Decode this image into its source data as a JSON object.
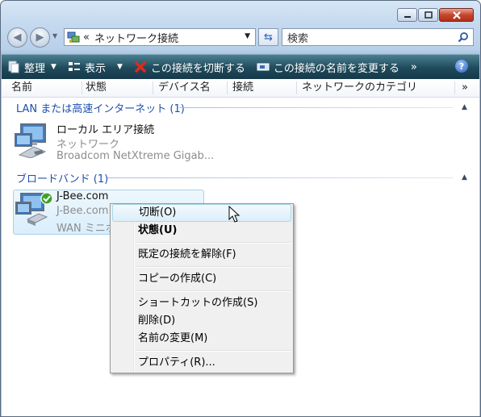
{
  "nav": {
    "address_prefix": "«",
    "address": "ネットワーク接続",
    "search_placeholder": "検索"
  },
  "toolbar": {
    "organize": "整理",
    "view": "表示",
    "disconnect": "この接続を切断する",
    "rename": "この接続の名前を変更する",
    "more": "»",
    "help": "?"
  },
  "columns": [
    "名前",
    "状態",
    "デバイス名",
    "接続",
    "ネットワークのカテゴリ"
  ],
  "columns_more": "»",
  "groups": [
    {
      "title": "LAN または高速インターネット (1)",
      "items": [
        {
          "name": "ローカル エリア接続",
          "status": "ネットワーク",
          "device": "Broadcom NetXtreme Gigab..."
        }
      ]
    },
    {
      "title": "ブロードバンド (1)",
      "items": [
        {
          "name": "J-Bee.com",
          "status": "J-Bee.com",
          "device": "WAN ミニポ"
        }
      ]
    }
  ],
  "context_menu": {
    "items": [
      "切断(O)",
      "状態(U)",
      "既定の接続を解除(F)",
      "コピーの作成(C)",
      "ショートカットの作成(S)",
      "削除(D)",
      "名前の変更(M)",
      "プロパティ(R)..."
    ]
  },
  "colors": {
    "toolbar": "#1f4a5b",
    "group_title": "#1e4fb0",
    "selection": "#d9eefb"
  }
}
